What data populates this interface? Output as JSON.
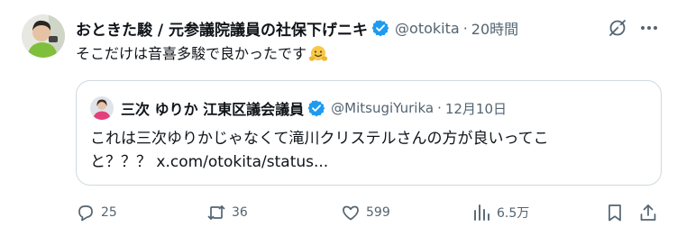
{
  "tweet": {
    "display_name": "おときた駿 / 元参議院議員の社保下げニキ",
    "handle": "@otokita",
    "separator": "·",
    "time": "20時間",
    "text": "そこだけは音喜多駿で良かったです"
  },
  "quote": {
    "display_name": "三次 ゆりか 江東区議会議員",
    "handle": "@MitsugiYurika",
    "separator": "·",
    "time": "12月10日",
    "text_line1": "これは三次ゆりかじゃなくて滝川クリステルさんの方が良いってこ",
    "text_line2": "と？？？ x.com/otokita/status..."
  },
  "actions": {
    "reply_count": "25",
    "retweet_count": "36",
    "like_count": "599",
    "view_count": "6.5万"
  },
  "icons": {
    "verified": "verified-badge-icon",
    "grok": "grok-icon",
    "more": "more-icon",
    "emoji": "hugging-face-emoji",
    "reply": "reply-icon",
    "retweet": "retweet-icon",
    "like": "heart-icon",
    "views": "views-chart-icon",
    "bookmark": "bookmark-icon",
    "share": "share-icon"
  },
  "colors": {
    "verified_blue": "#1d9bf0",
    "secondary_text": "#536471",
    "border": "#cfd9de"
  }
}
